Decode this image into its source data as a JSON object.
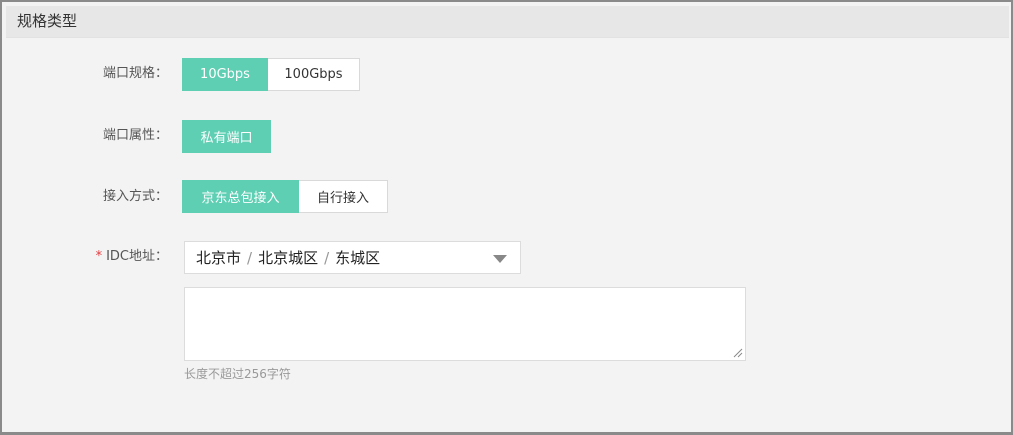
{
  "panel": {
    "title": "规格类型"
  },
  "rows": {
    "port_spec": {
      "label": "端口规格：",
      "options": [
        "10Gbps",
        "100Gbps"
      ],
      "selected": "10Gbps"
    },
    "port_attr": {
      "label": "端口属性：",
      "options": [
        "私有端口"
      ],
      "selected": "私有端口"
    },
    "access_mode": {
      "label": "接入方式：",
      "options": [
        "京东总包接入",
        "自行接入"
      ],
      "selected": "京东总包接入"
    },
    "idc": {
      "required_mark": "*",
      "label": "IDC地址：",
      "path": [
        "北京市",
        "北京城区",
        "东城区"
      ],
      "separator": "/",
      "textarea_value": "",
      "hint": "长度不超过256字符"
    }
  },
  "colors": {
    "accent": "#5ecfb3",
    "required": "#e4393c"
  }
}
